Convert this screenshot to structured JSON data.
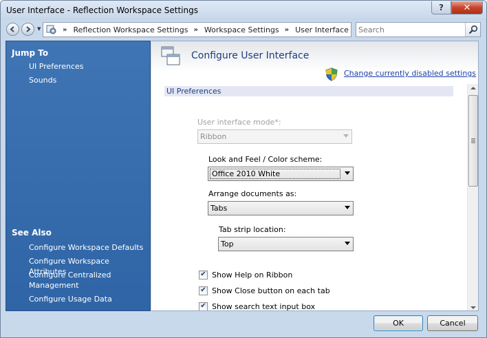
{
  "window": {
    "title": "User Interface - Reflection Workspace Settings",
    "help_glyph": "?",
    "close_glyph": "✕"
  },
  "navbar": {
    "breadcrumbs": [
      "Reflection Workspace Settings",
      "Workspace Settings",
      "User Interface"
    ],
    "separator": "»",
    "search_placeholder": "Search"
  },
  "left_pane": {
    "jump_to": {
      "heading": "Jump To",
      "links": [
        "UI Preferences",
        "Sounds"
      ]
    },
    "see_also": {
      "heading": "See Also",
      "links": [
        "Configure Workspace Defaults",
        "Configure Workspace Attributes",
        "Configure Centralized Management",
        "Configure Usage Data"
      ]
    }
  },
  "main": {
    "title": "Configure User Interface",
    "change_settings_link": "Change currently disabled settings",
    "section_title": "UI Preferences",
    "ui_mode": {
      "label": "User interface mode*:",
      "value": "Ribbon",
      "enabled": false
    },
    "color_scheme": {
      "label": "Look and Feel / Color scheme:",
      "value": "Office 2010 White"
    },
    "arrange_docs": {
      "label": "Arrange documents as:",
      "value": "Tabs"
    },
    "tab_strip": {
      "label": "Tab strip location:",
      "value": "Top"
    },
    "checkboxes": [
      {
        "label": "Show Help on Ribbon",
        "checked": true
      },
      {
        "label": "Show Close button on each tab",
        "checked": true
      },
      {
        "label": "Show search text input box",
        "checked": true
      }
    ],
    "check_glyph": "✔"
  },
  "buttons": {
    "ok": "OK",
    "cancel": "Cancel"
  },
  "colors": {
    "left_pane": "#3a70b0",
    "link": "#1b3fa7",
    "title": "#1c3e7d"
  }
}
